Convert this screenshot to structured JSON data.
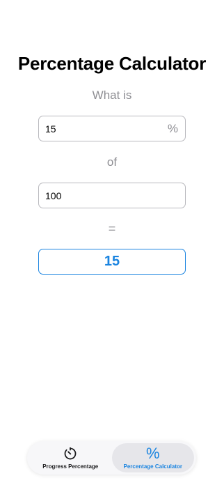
{
  "page": {
    "title": "Percentage Calculator"
  },
  "calculator": {
    "what_is_label": "What is",
    "percent_value": "15",
    "percent_suffix": "%",
    "of_label": "of",
    "base_value": "100",
    "equals_label": "=",
    "result_value": "15"
  },
  "tabbar": {
    "tabs": [
      {
        "label": "Progress Percentage",
        "icon": "timer-icon",
        "active": false
      },
      {
        "label": "Percentage Calculator",
        "icon": "percent-icon",
        "active": true
      }
    ]
  },
  "colors": {
    "accent": "#1a84e0",
    "secondary_text": "#8e8e93"
  }
}
